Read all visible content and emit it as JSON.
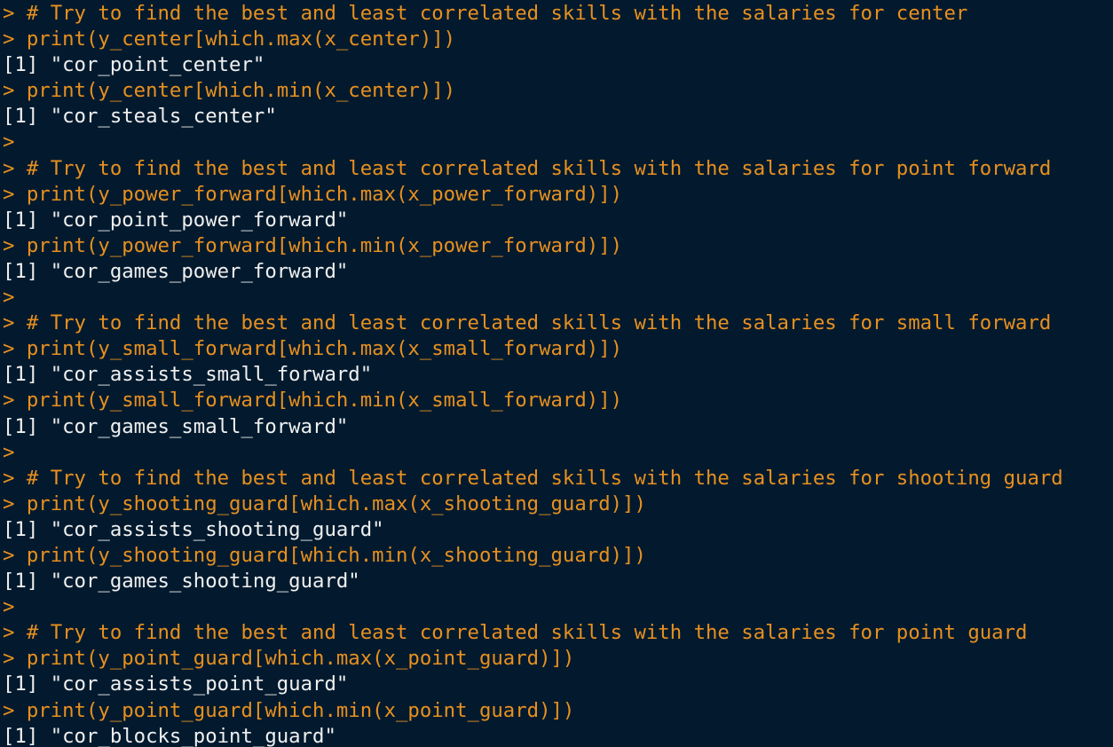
{
  "console": {
    "colors": {
      "background": "#031a2e",
      "input": "#e8901f",
      "output": "#f0f0f0"
    },
    "lines": [
      {
        "type": "input",
        "text": "> # Try to find the best and least correlated skills with the salaries for center"
      },
      {
        "type": "input",
        "text": "> print(y_center[which.max(x_center)])"
      },
      {
        "type": "output",
        "text": "[1] \"cor_point_center\""
      },
      {
        "type": "input",
        "text": "> print(y_center[which.min(x_center)])"
      },
      {
        "type": "output",
        "text": "[1] \"cor_steals_center\""
      },
      {
        "type": "input",
        "text": ">"
      },
      {
        "type": "input",
        "text": "> # Try to find the best and least correlated skills with the salaries for point forward"
      },
      {
        "type": "input",
        "text": "> print(y_power_forward[which.max(x_power_forward)])"
      },
      {
        "type": "output",
        "text": "[1] \"cor_point_power_forward\""
      },
      {
        "type": "input",
        "text": "> print(y_power_forward[which.min(x_power_forward)])"
      },
      {
        "type": "output",
        "text": "[1] \"cor_games_power_forward\""
      },
      {
        "type": "input",
        "text": ">"
      },
      {
        "type": "input",
        "text": "> # Try to find the best and least correlated skills with the salaries for small forward"
      },
      {
        "type": "input",
        "text": "> print(y_small_forward[which.max(x_small_forward)])"
      },
      {
        "type": "output",
        "text": "[1] \"cor_assists_small_forward\""
      },
      {
        "type": "input",
        "text": "> print(y_small_forward[which.min(x_small_forward)])"
      },
      {
        "type": "output",
        "text": "[1] \"cor_games_small_forward\""
      },
      {
        "type": "input",
        "text": ">"
      },
      {
        "type": "input",
        "text": "> # Try to find the best and least correlated skills with the salaries for shooting guard"
      },
      {
        "type": "input",
        "text": "> print(y_shooting_guard[which.max(x_shooting_guard)])"
      },
      {
        "type": "output",
        "text": "[1] \"cor_assists_shooting_guard\""
      },
      {
        "type": "input",
        "text": "> print(y_shooting_guard[which.min(x_shooting_guard)])"
      },
      {
        "type": "output",
        "text": "[1] \"cor_games_shooting_guard\""
      },
      {
        "type": "input",
        "text": ">"
      },
      {
        "type": "input",
        "text": "> # Try to find the best and least correlated skills with the salaries for point guard"
      },
      {
        "type": "input",
        "text": "> print(y_point_guard[which.max(x_point_guard)])"
      },
      {
        "type": "output",
        "text": "[1] \"cor_assists_point_guard\""
      },
      {
        "type": "input",
        "text": "> print(y_point_guard[which.min(x_point_guard)])"
      },
      {
        "type": "output",
        "text": "[1] \"cor_blocks_point_guard\""
      }
    ]
  }
}
